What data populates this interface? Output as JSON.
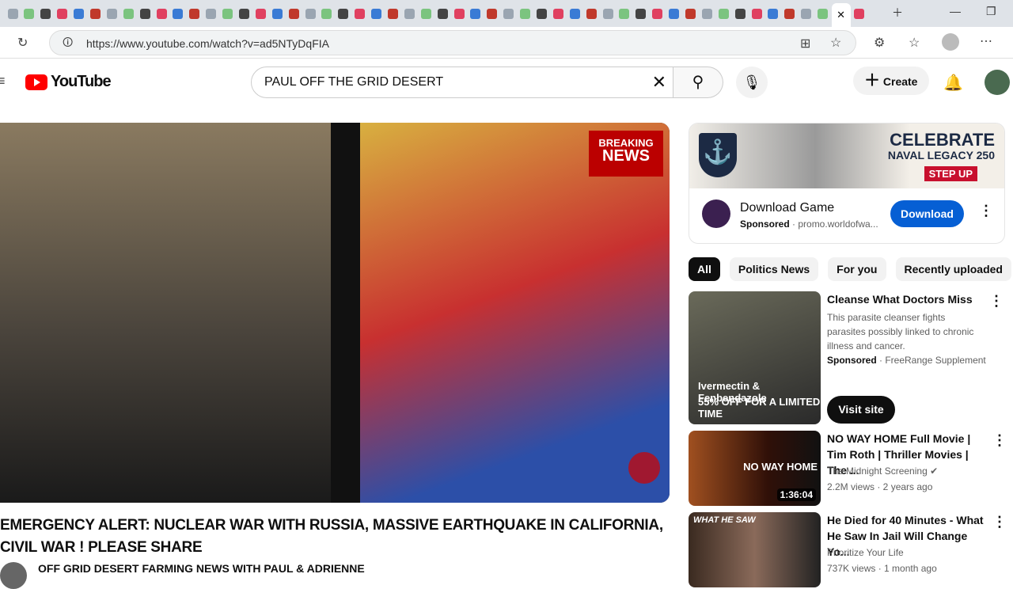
{
  "browser": {
    "url": "https://www.youtube.com/watch?v=ad5NTyDqFIA",
    "tab_count": 52
  },
  "youtube": {
    "logo": "YouTube",
    "search_value": "PAUL OFF THE GRID DESERT",
    "create_label": "Create"
  },
  "video": {
    "breaking_line1": "BREAKING",
    "breaking_line2": "NEWS",
    "title": "EMERGENCY ALERT: NUCLEAR WAR WITH RUSSIA, MASSIVE EARTHQUAKE IN CALIFORNIA, CIVIL WAR ! PLEASE SHARE",
    "channel": "OFF GRID DESERT FARMING NEWS WITH PAUL & ADRIENNE"
  },
  "ad": {
    "banner_line1": "CELEBRATE",
    "banner_line2": "NAVAL LEGACY 250",
    "banner_cta": "STEP UP",
    "title": "Download Game",
    "sponsored": "Sponsored",
    "domain": "· promo.worldofwa...",
    "button": "Download"
  },
  "chips": [
    "All",
    "Politics News",
    "For you",
    "Recently uploaded"
  ],
  "recs": [
    {
      "title": "Cleanse What Doctors Miss",
      "desc": "This parasite cleanser fights parasites possibly linked to chronic illness and cancer.",
      "sponsored": "Sponsored",
      "advertiser": "· FreeRange Supplement",
      "thumb_line1": "Ivermectin & Fenbendazole",
      "thumb_line2": "55% OFF FOR A LIMITED TIME",
      "button": "Visit site"
    },
    {
      "title": "NO WAY HOME Full Movie | Tim Roth | Thriller Movies | The ...",
      "channel": "The Midnight Screening",
      "meta": "2.2M views · 2 years ago",
      "duration": "1:36:04",
      "thumb_text": "NO WAY HOME"
    },
    {
      "title": "He Died for 40 Minutes -  What He Saw In Jail Will Change Yo...",
      "channel": "Prioritize Your Life",
      "meta": "737K views · 1 month ago",
      "thumb_text": "WHAT HE SAW"
    }
  ]
}
